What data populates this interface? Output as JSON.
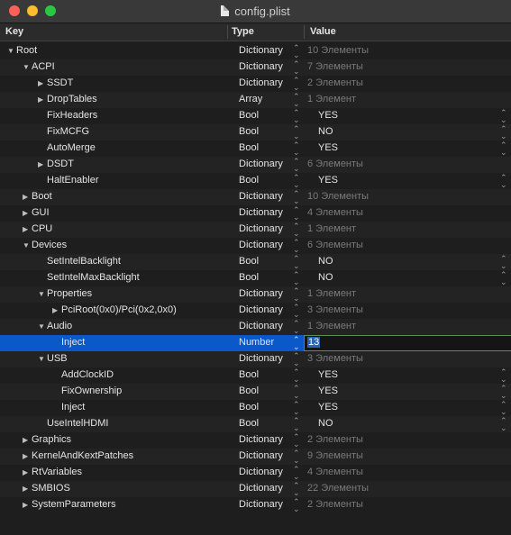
{
  "window": {
    "title": "config.plist"
  },
  "columns": {
    "key": "Key",
    "type": "Type",
    "value": "Value"
  },
  "rows": [
    {
      "key": "Root",
      "indent": 0,
      "tri": "down",
      "type": "Dictionary",
      "value": "10 Элементы",
      "kind": "count"
    },
    {
      "key": "ACPI",
      "indent": 1,
      "tri": "down",
      "type": "Dictionary",
      "value": "7 Элементы",
      "kind": "count"
    },
    {
      "key": "SSDT",
      "indent": 2,
      "tri": "right",
      "type": "Dictionary",
      "value": "2 Элементы",
      "kind": "count"
    },
    {
      "key": "DropTables",
      "indent": 2,
      "tri": "right",
      "type": "Array",
      "value": "1 Элемент",
      "kind": "count"
    },
    {
      "key": "FixHeaders",
      "indent": 2,
      "tri": "",
      "type": "Bool",
      "value": "YES",
      "kind": "bool"
    },
    {
      "key": "FixMCFG",
      "indent": 2,
      "tri": "",
      "type": "Bool",
      "value": "NO",
      "kind": "bool"
    },
    {
      "key": "AutoMerge",
      "indent": 2,
      "tri": "",
      "type": "Bool",
      "value": "YES",
      "kind": "bool"
    },
    {
      "key": "DSDT",
      "indent": 2,
      "tri": "right",
      "type": "Dictionary",
      "value": "6 Элементы",
      "kind": "count"
    },
    {
      "key": "HaltEnabler",
      "indent": 2,
      "tri": "",
      "type": "Bool",
      "value": "YES",
      "kind": "bool"
    },
    {
      "key": "Boot",
      "indent": 1,
      "tri": "right",
      "type": "Dictionary",
      "value": "10 Элементы",
      "kind": "count"
    },
    {
      "key": "GUI",
      "indent": 1,
      "tri": "right",
      "type": "Dictionary",
      "value": "4 Элементы",
      "kind": "count"
    },
    {
      "key": "CPU",
      "indent": 1,
      "tri": "right",
      "type": "Dictionary",
      "value": "1 Элемент",
      "kind": "count"
    },
    {
      "key": "Devices",
      "indent": 1,
      "tri": "down",
      "type": "Dictionary",
      "value": "6 Элементы",
      "kind": "count"
    },
    {
      "key": "SetIntelBacklight",
      "indent": 2,
      "tri": "",
      "type": "Bool",
      "value": "NO",
      "kind": "bool"
    },
    {
      "key": "SetIntelMaxBacklight",
      "indent": 2,
      "tri": "",
      "type": "Bool",
      "value": "NO",
      "kind": "bool"
    },
    {
      "key": "Properties",
      "indent": 2,
      "tri": "down",
      "type": "Dictionary",
      "value": "1 Элемент",
      "kind": "count"
    },
    {
      "key": "PciRoot(0x0)/Pci(0x2,0x0)",
      "indent": 3,
      "tri": "right",
      "type": "Dictionary",
      "value": "3 Элементы",
      "kind": "count"
    },
    {
      "key": "Audio",
      "indent": 2,
      "tri": "down",
      "type": "Dictionary",
      "value": "1 Элемент",
      "kind": "count"
    },
    {
      "key": "Inject",
      "indent": 3,
      "tri": "",
      "type": "Number",
      "value": "13",
      "kind": "edit",
      "selected": true
    },
    {
      "key": "USB",
      "indent": 2,
      "tri": "down",
      "type": "Dictionary",
      "value": "3 Элементы",
      "kind": "count"
    },
    {
      "key": "AddClockID",
      "indent": 3,
      "tri": "",
      "type": "Bool",
      "value": "YES",
      "kind": "bool"
    },
    {
      "key": "FixOwnership",
      "indent": 3,
      "tri": "",
      "type": "Bool",
      "value": "YES",
      "kind": "bool"
    },
    {
      "key": "Inject",
      "indent": 3,
      "tri": "",
      "type": "Bool",
      "value": "YES",
      "kind": "bool"
    },
    {
      "key": "UseIntelHDMI",
      "indent": 2,
      "tri": "",
      "type": "Bool",
      "value": "NO",
      "kind": "bool"
    },
    {
      "key": "Graphics",
      "indent": 1,
      "tri": "right",
      "type": "Dictionary",
      "value": "2 Элементы",
      "kind": "count"
    },
    {
      "key": "KernelAndKextPatches",
      "indent": 1,
      "tri": "right",
      "type": "Dictionary",
      "value": "9 Элементы",
      "kind": "count"
    },
    {
      "key": "RtVariables",
      "indent": 1,
      "tri": "right",
      "type": "Dictionary",
      "value": "4 Элементы",
      "kind": "count"
    },
    {
      "key": "SMBIOS",
      "indent": 1,
      "tri": "right",
      "type": "Dictionary",
      "value": "22 Элементы",
      "kind": "count"
    },
    {
      "key": "SystemParameters",
      "indent": 1,
      "tri": "right",
      "type": "Dictionary",
      "value": "2 Элементы",
      "kind": "count"
    }
  ]
}
